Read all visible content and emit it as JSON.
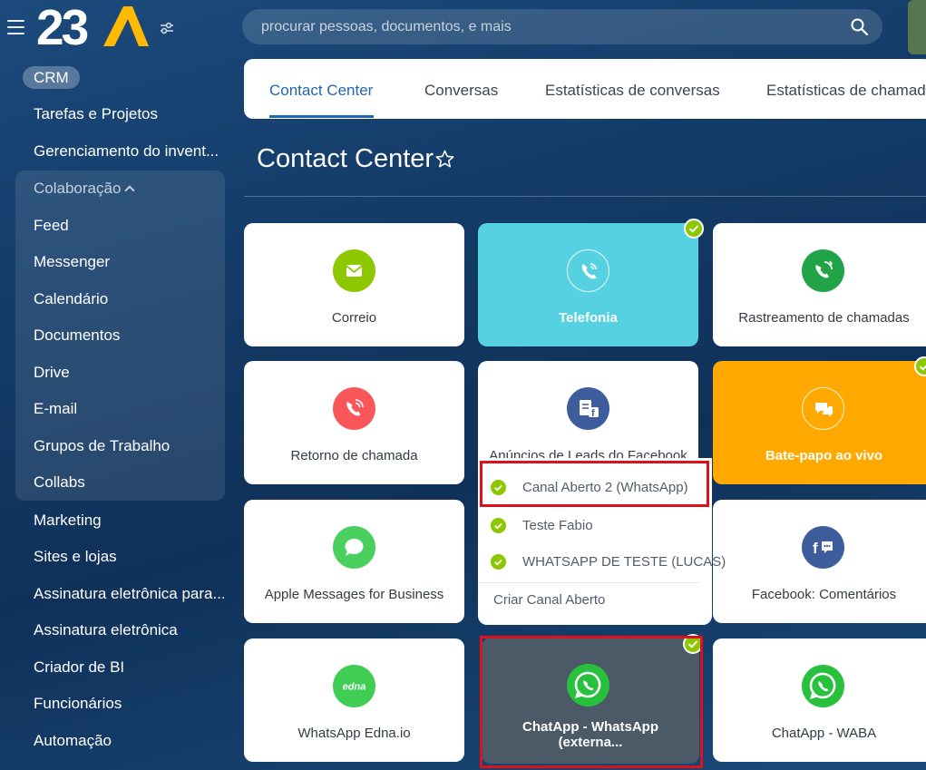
{
  "brand": {
    "logo_text": "23A"
  },
  "search": {
    "placeholder": "procurar pessoas, documentos, e mais"
  },
  "sidebar": {
    "crm_label": "CRM",
    "items_top": [
      "Tarefas e Projetos",
      "Gerenciamento do invent..."
    ],
    "collab_label": "Colaboração",
    "collab_items": [
      "Feed",
      "Messenger",
      "Calendário",
      "Documentos",
      "Drive",
      "E-mail",
      "Grupos de Trabalho",
      "Collabs"
    ],
    "items_bottom": [
      "Marketing",
      "Sites e lojas",
      "Assinatura eletrônica para...",
      "Assinatura eletrônica",
      "Criador de BI",
      "Funcionários",
      "Automação"
    ]
  },
  "tabs": [
    "Contact Center",
    "Conversas",
    "Estatísticas de conversas",
    "Estatísticas de chamada"
  ],
  "page": {
    "title": "Contact Center"
  },
  "cards": [
    {
      "label": "Correio",
      "icon": "envelope-icon",
      "icon_color": "#8cc700"
    },
    {
      "label": "Telefonia",
      "icon": "phone-icon",
      "icon_color": "#56d1e1",
      "connected": true
    },
    {
      "label": "Rastreamento de chamadas",
      "icon": "call-tracking-icon",
      "icon_color": "#21a347"
    },
    {
      "label": "Retorno de chamada",
      "icon": "callback-icon",
      "icon_color": "#f9575a"
    },
    {
      "label": "Anúncios de Leads do Facebook",
      "icon": "facebook-leads-icon",
      "icon_color": "#3d5d9c"
    },
    {
      "label": "Bate-papo ao vivo",
      "icon": "chat-icon",
      "icon_color": "#ffa900",
      "connected": true
    },
    {
      "label": "Apple Messages for Business",
      "icon": "speech-bubble-icon",
      "icon_color": "#49d05f"
    },
    {
      "label": "Facebook: Comentários",
      "icon": "facebook-comments-icon",
      "icon_color": "#3d5d9c"
    },
    {
      "label": "WhatsApp Edna.io",
      "icon": "edna-icon",
      "icon_color": "#3fcd53",
      "icon_text": "edna"
    },
    {
      "label": "ChatApp - WhatsApp (externa...",
      "icon": "whatsapp-icon",
      "icon_color": "#27c13e",
      "connected": true
    },
    {
      "label": "ChatApp - WABA",
      "icon": "whatsapp-icon",
      "icon_color": "#27c13e"
    }
  ],
  "channel_dropdown": {
    "items": [
      "Canal Aberto 2 (WhatsApp)",
      "Teste Fabio",
      "WHATSAPP DE TESTE (LUCAS)"
    ],
    "create_label": "Criar Canal Aberto"
  },
  "colors": {
    "accent": "#2067b0",
    "connected_check": "#8cc700",
    "highlight": "#e00f1a"
  }
}
